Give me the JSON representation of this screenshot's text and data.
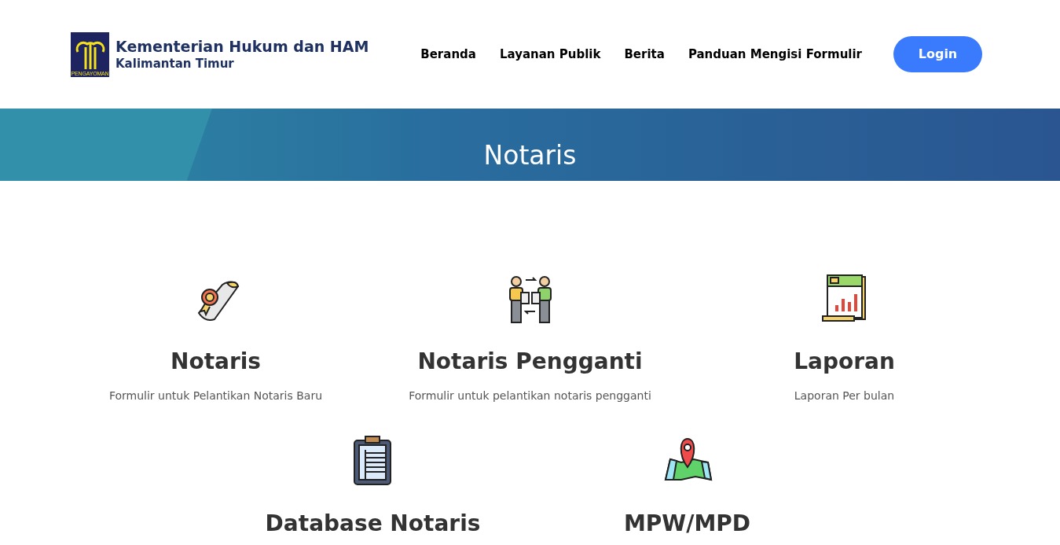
{
  "header": {
    "logo": {
      "emblem_text": "PENGAYOMAN",
      "title": "Kementerian Hukum dan HAM",
      "subtitle": "Kalimantan Timur"
    },
    "nav": [
      {
        "label": "Beranda"
      },
      {
        "label": "Layanan Publik"
      },
      {
        "label": "Berita"
      },
      {
        "label": "Panduan Mengisi Formulir"
      }
    ],
    "login_button": "Login"
  },
  "banner": {
    "title": "Notaris"
  },
  "services": [
    {
      "kind": "certificate",
      "title": "Notaris",
      "description": "Formulir untuk Pelantikan Notaris Baru"
    },
    {
      "kind": "exchange",
      "title": "Notaris Pengganti",
      "description": "Formulir untuk pelantikan notaris pengganti"
    },
    {
      "kind": "report",
      "title": "Laporan",
      "description": "Laporan Per bulan"
    },
    {
      "kind": "clipboard",
      "title": "Database Notaris"
    },
    {
      "kind": "map",
      "title": "MPW/MPD"
    }
  ]
}
